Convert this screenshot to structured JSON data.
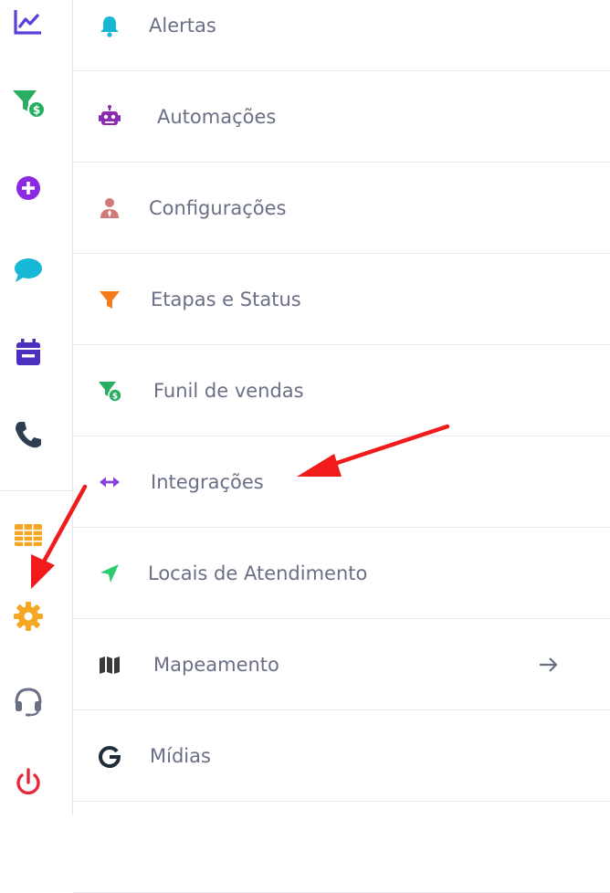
{
  "menu": {
    "items": [
      {
        "label": "Alertas"
      },
      {
        "label": "Automações"
      },
      {
        "label": "Configurações"
      },
      {
        "label": "Etapas e Status"
      },
      {
        "label": "Funil de vendas"
      },
      {
        "label": "Integrações"
      },
      {
        "label": "Locais de Atendimento"
      },
      {
        "label": "Mapeamento"
      },
      {
        "label": "Mídias"
      }
    ]
  },
  "icons": {
    "rail": [
      "chart-line-icon",
      "funnel-dollar-icon",
      "plus-circle-icon",
      "chat-bubble-icon",
      "calendar-icon",
      "phone-icon",
      "table-grid-icon",
      "gear-icon",
      "headset-icon",
      "power-icon"
    ],
    "menu": [
      "bell-icon",
      "robot-icon",
      "user-tie-icon",
      "filter-icon",
      "funnel-dollar-icon",
      "arrows-horizontal-icon",
      "location-arrow-icon",
      "map-icon",
      "google-icon"
    ]
  },
  "colors": {
    "purple": "#5b3fd9",
    "green": "#27ae60",
    "violet": "#8a2be2",
    "cyan": "#17b8d6",
    "navy": "#2c3e50",
    "amber": "#f5a623",
    "red": "#e8283a",
    "annotation_red": "#f21b1b",
    "label_text": "#6b6f85"
  }
}
